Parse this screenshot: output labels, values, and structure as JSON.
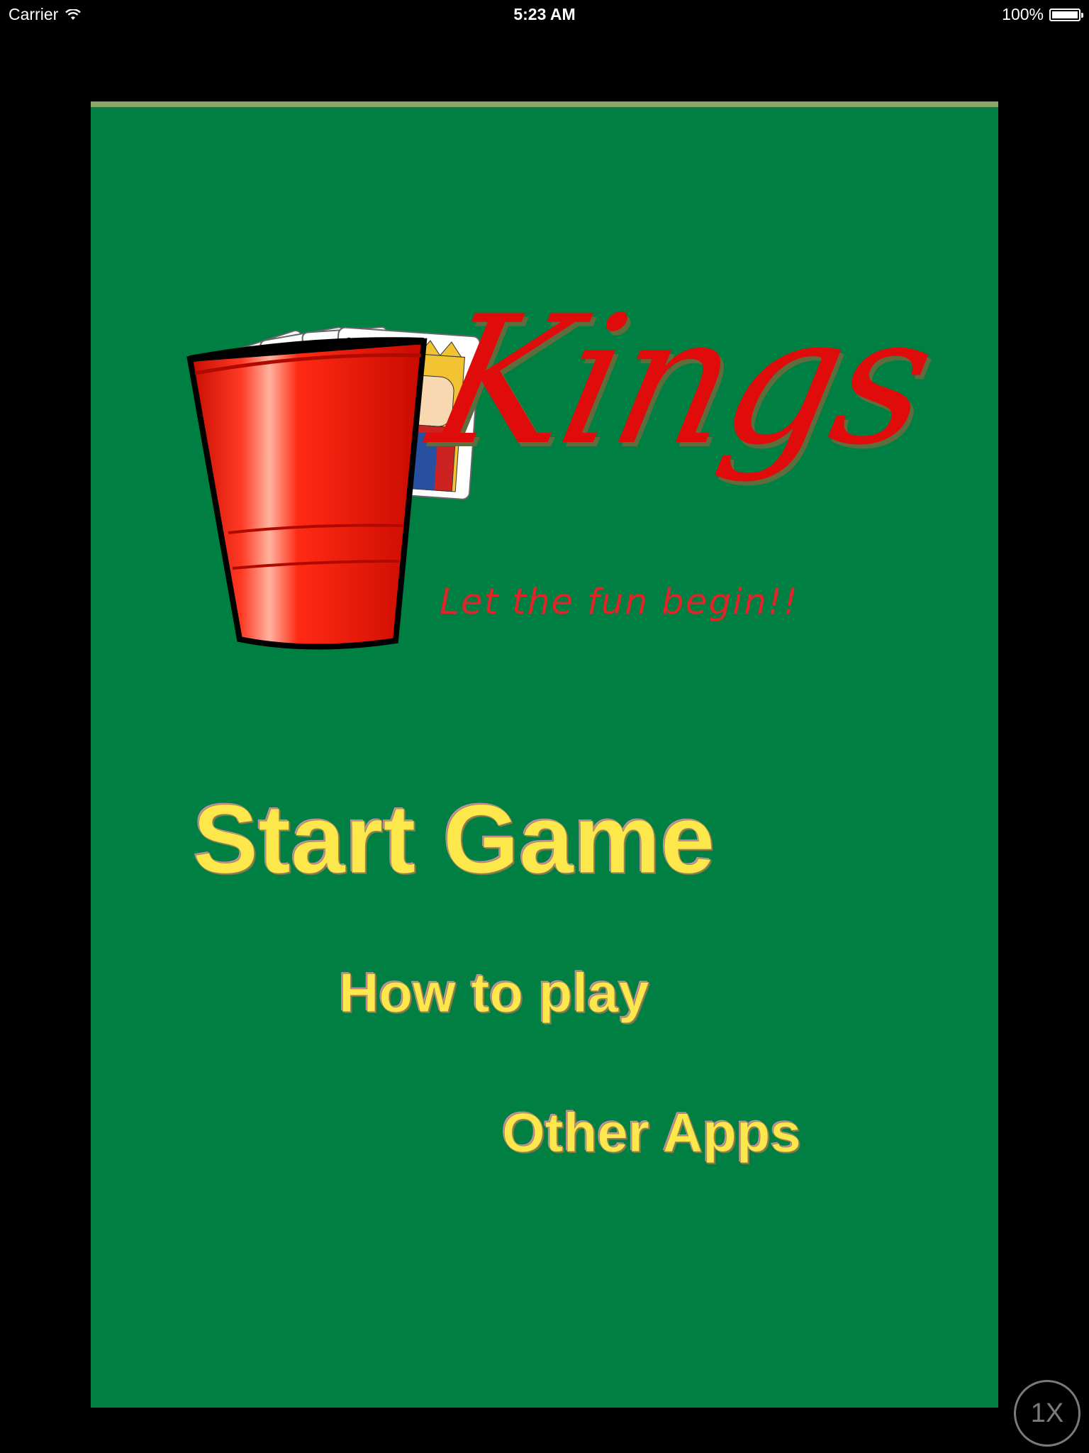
{
  "status_bar": {
    "carrier": "Carrier",
    "time": "5:23 AM",
    "battery_percent": "100%",
    "battery_level": 1.0
  },
  "logo": {
    "title": "Kings",
    "tagline": "Let the fun begin!!"
  },
  "menu": {
    "start_game": "Start Game",
    "how_to_play": "How to play",
    "other_apps": "Other Apps"
  },
  "zoom_badge": "1X",
  "colors": {
    "background": "#000000",
    "panel": "#007f42",
    "menu_text": "#fde84c",
    "logo_red": "#e00c0c",
    "cup_red": "#ff1a0a"
  },
  "icons": {
    "wifi": "wifi-icon",
    "battery": "battery-icon",
    "cup": "red-cup-icon",
    "cards": "king-cards-icon"
  }
}
